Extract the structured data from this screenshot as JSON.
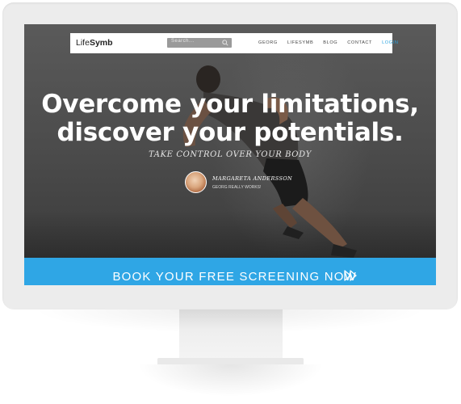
{
  "navbar": {
    "logo_light": "Life",
    "logo_bold": "Symb",
    "search_placeholder": "Search...",
    "items": [
      {
        "label": "GEORG"
      },
      {
        "label": "LIFESYMB"
      },
      {
        "label": "BLOG"
      },
      {
        "label": "CONTACT"
      },
      {
        "label": "LOGIN"
      }
    ]
  },
  "hero": {
    "headline_line1": "Overcome your limitations,",
    "headline_line2": "discover your potentials.",
    "subline": "TAKE CONTROL OVER YOUR BODY",
    "testimonial": {
      "name": "MARGARETA ANDERSSON",
      "quote": "GEORG REALLY WORKS!"
    }
  },
  "cta": {
    "label": "BOOK YOUR FREE SCREENING NOW",
    "icon": "fast-forward-icon"
  },
  "colors": {
    "accent": "#2fa6e5",
    "login": "#29a4e0"
  }
}
